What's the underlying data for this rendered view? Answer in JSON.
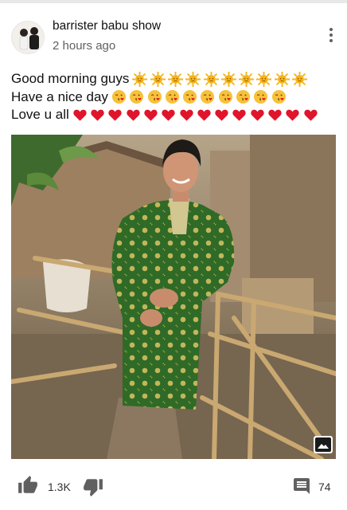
{
  "post": {
    "channel_name": "barrister babu show",
    "time_ago": "2 hours ago",
    "lines": [
      {
        "text": "Good morning guys",
        "emoji": "sun-emoji",
        "emoji_count": 10
      },
      {
        "text": "Have a nice day",
        "emoji": "kissing-face-emoji",
        "emoji_count": 10
      },
      {
        "text": "Love u all",
        "emoji": "red-heart-emoji",
        "emoji_count": 14
      }
    ],
    "image": {
      "subject": "person-in-green-kurta-photo",
      "badge_icon": "image-icon"
    }
  },
  "actions": {
    "like_icon": "thumbs-up-icon",
    "like_count": "1.3K",
    "dislike_icon": "thumbs-down-icon",
    "comment_icon": "comment-icon",
    "comment_count": "74",
    "menu_icon": "more-vert-icon"
  },
  "colors": {
    "text": "#111111",
    "secondary_text": "#606060",
    "icon": "#606060",
    "heart": "#e0142b",
    "sun": "#f5b31a"
  }
}
